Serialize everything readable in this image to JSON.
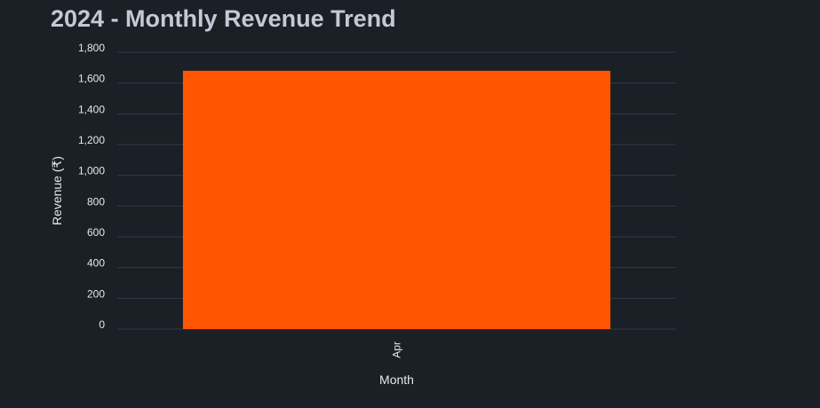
{
  "chart_data": {
    "type": "bar",
    "title": "2024 - Monthly Revenue Trend",
    "xlabel": "Month",
    "ylabel": "Revenue (₹)",
    "categories": [
      "Apr"
    ],
    "series": [
      {
        "values": [
          1680
        ]
      }
    ],
    "ylim": [
      0,
      1800
    ],
    "yticks": [
      0,
      200,
      400,
      600,
      800,
      1000,
      1200,
      1400,
      1600,
      1800
    ],
    "ytick_labels": [
      "0",
      "200",
      "400",
      "600",
      "800",
      "1,000",
      "1,200",
      "1,400",
      "1,600",
      "1,800"
    ],
    "grid": true,
    "bar_color": "#ff5500",
    "background": "#1b1f26",
    "x_tick_rotation": "vertical"
  }
}
